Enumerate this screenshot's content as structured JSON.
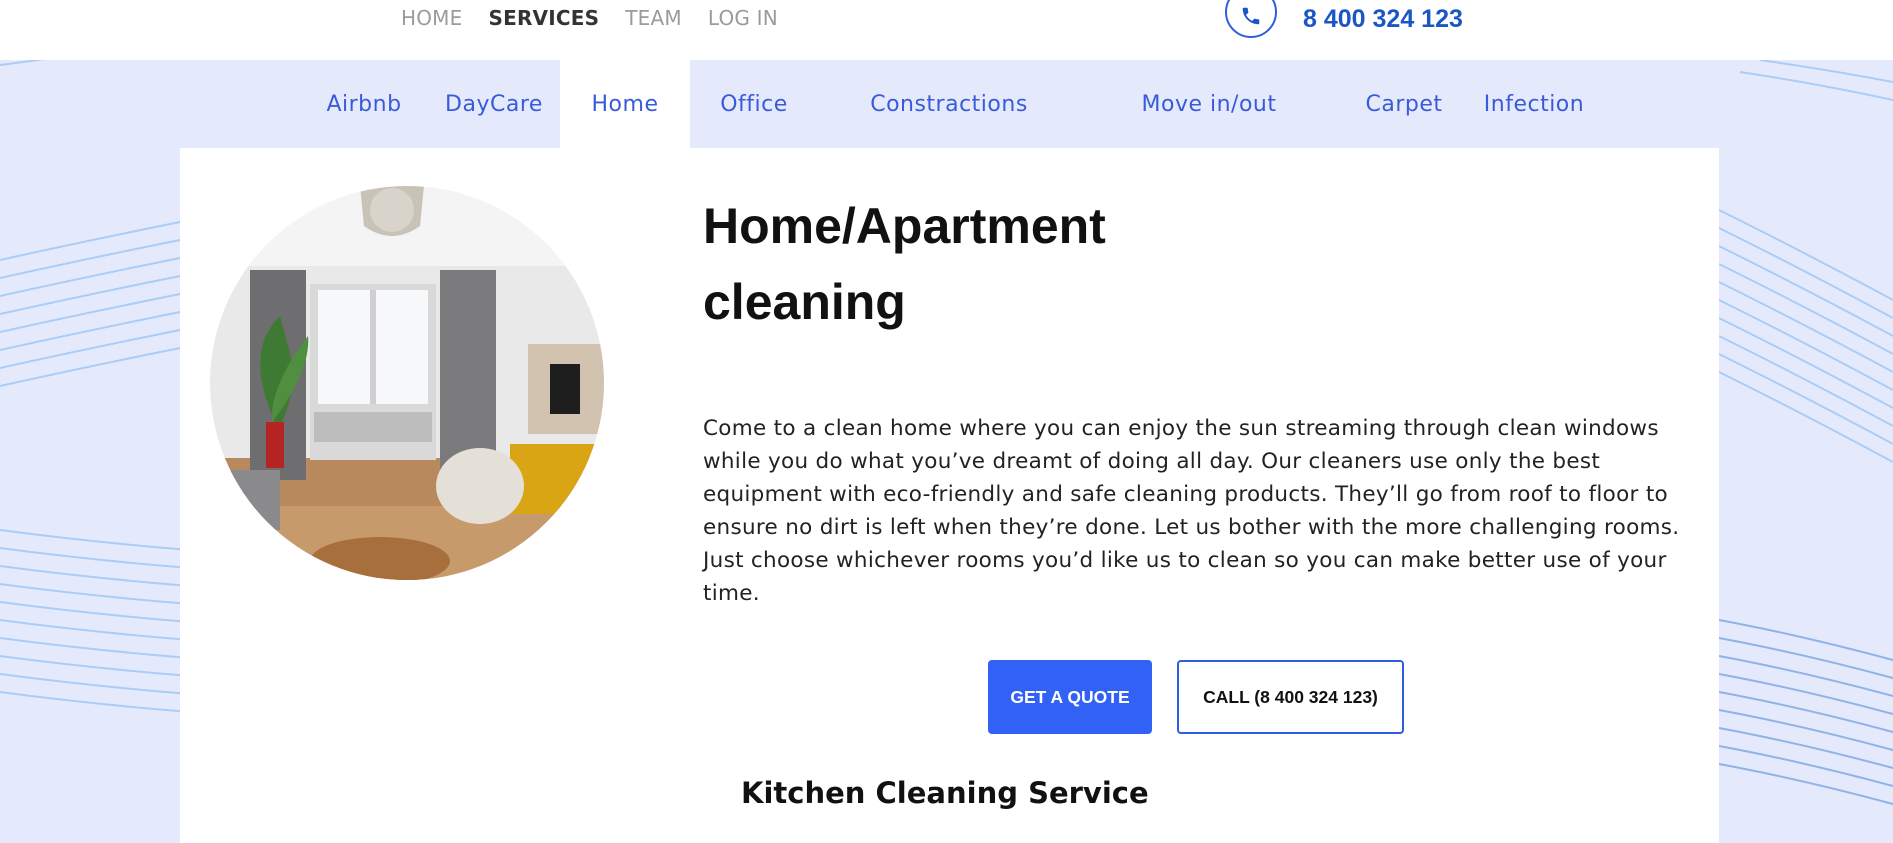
{
  "top_nav": {
    "items": [
      {
        "label": "HOME",
        "active": false
      },
      {
        "label": "SERVICES",
        "active": true
      },
      {
        "label": "TEAM",
        "active": false
      },
      {
        "label": "LOG IN",
        "active": false
      }
    ]
  },
  "contact": {
    "phone": "8 400 324 123",
    "icon": "phone-icon"
  },
  "service_tabs": [
    {
      "label": "Airbnb"
    },
    {
      "label": "DayCare"
    },
    {
      "label": "Home",
      "active": true
    },
    {
      "label": "Office"
    },
    {
      "label": "Constractions"
    },
    {
      "label": "Move in/out"
    },
    {
      "label": "Carpet"
    },
    {
      "label": "Infection"
    }
  ],
  "main": {
    "title": "Home/Apartment cleaning",
    "description": "Come to a clean home where you can enjoy the sun streaming through clean windows while you do what you’ve dreamt of doing all day. Our cleaners use only the best equipment with eco-friendly and safe cleaning products. They’ll go from roof to floor to ensure no dirt is left when they’re done. Let us bother with the more challenging rooms. Just choose whichever rooms you’d like us to clean so you can make better use of your time.",
    "buttons": {
      "quote": "GET A QUOTE",
      "call": "CALL (8 400 324 123)"
    },
    "next_section_title": "Kitchen Cleaning Service"
  },
  "colors": {
    "accent": "#3161f5",
    "tab_text": "#3a5bd9",
    "background": "#e4eafc",
    "phone_text": "#1b57c4"
  }
}
